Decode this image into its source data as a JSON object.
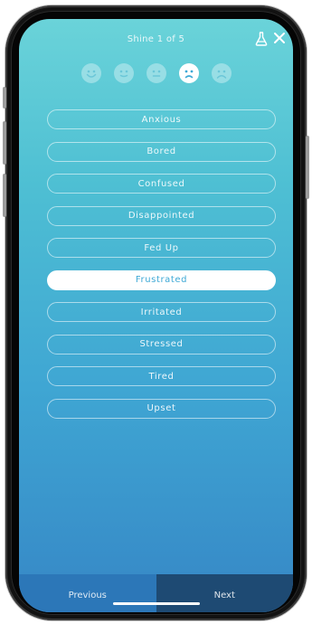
{
  "header": {
    "title": "Shine 1 of 5",
    "icons": [
      "flask-icon",
      "close-icon"
    ]
  },
  "moods": [
    {
      "name": "very-happy-face-icon",
      "selected": false
    },
    {
      "name": "happy-face-icon",
      "selected": false
    },
    {
      "name": "neutral-face-icon",
      "selected": false
    },
    {
      "name": "sad-face-icon",
      "selected": true
    },
    {
      "name": "very-sad-face-icon",
      "selected": false
    }
  ],
  "options": [
    {
      "label": "Anxious",
      "selected": false
    },
    {
      "label": "Bored",
      "selected": false
    },
    {
      "label": "Confused",
      "selected": false
    },
    {
      "label": "Disappointed",
      "selected": false
    },
    {
      "label": "Fed Up",
      "selected": false
    },
    {
      "label": "Frustrated",
      "selected": true
    },
    {
      "label": "Irritated",
      "selected": false
    },
    {
      "label": "Stressed",
      "selected": false
    },
    {
      "label": "Tired",
      "selected": false
    },
    {
      "label": "Upset",
      "selected": false
    }
  ],
  "nav": {
    "previous_label": "Previous",
    "next_label": "Next"
  },
  "colors": {
    "gradient_top": "#6ad3d9",
    "gradient_bottom": "#3687c6",
    "selected_text": "#3ea9d6",
    "nav_previous": "#2c77b8",
    "nav_next": "#1e4a73"
  }
}
